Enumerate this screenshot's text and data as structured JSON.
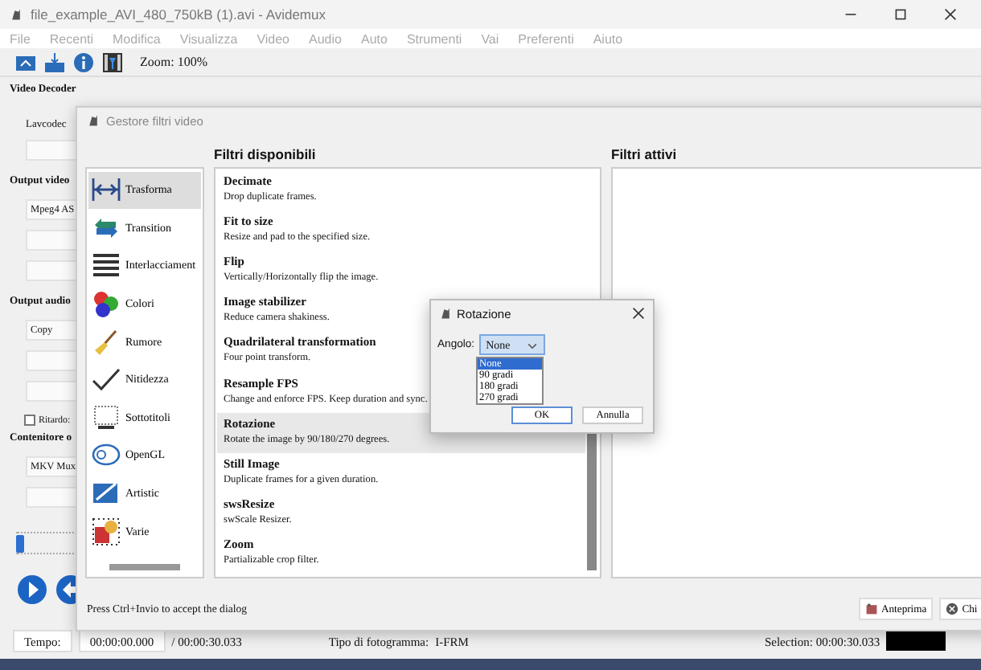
{
  "window": {
    "title": "file_example_AVI_480_750kB (1).avi - Avidemux"
  },
  "menu": [
    {
      "label": "File",
      "disabled": true
    },
    {
      "label": "Recenti",
      "disabled": true
    },
    {
      "label": "Modifica",
      "disabled": true
    },
    {
      "label": "Visualizza",
      "disabled": true
    },
    {
      "label": "Video",
      "disabled": true
    },
    {
      "label": "Audio",
      "disabled": true
    },
    {
      "label": "Auto",
      "disabled": true
    },
    {
      "label": "Strumenti",
      "disabled": true
    },
    {
      "label": "Vai",
      "disabled": true
    },
    {
      "label": "Preferenti",
      "disabled": true
    },
    {
      "label": "Aiuto",
      "disabled": true
    }
  ],
  "toolbar": {
    "zoom": "Zoom: 100%"
  },
  "main_panel": {
    "video_decoder_title": "Video Decoder",
    "decoder_label": "Lavcodec",
    "output_video_title": "Output video",
    "video_codec": "Mpeg4 AS",
    "output_audio_title": "Output audio",
    "audio_codec": "Copy",
    "delay": {
      "label": "Ritardo:",
      "checked": false
    },
    "container_title": "Contenitore o",
    "container": "MKV Mux"
  },
  "timeline": {
    "level": 0
  },
  "status_bar": {
    "time_label": "Tempo:",
    "time": "00:00:00.000",
    "duration": "/ 00:00:30.033",
    "frame_type_label": "Tipo di fotogramma:",
    "frame_type": "I-FRM",
    "selection": "Selection: 00:00:30.033"
  },
  "filter_dialog": {
    "title": "Gestore filtri video",
    "available_header": "Filtri disponibili",
    "active_header": "Filtri attivi",
    "categories": [
      {
        "label": "Trasforma",
        "selected": true
      },
      {
        "label": "Transition",
        "selected": false
      },
      {
        "label": "Interlacciament",
        "selected": false
      },
      {
        "label": "Colori",
        "selected": false
      },
      {
        "label": "Rumore",
        "selected": false
      },
      {
        "label": "Nitidezza",
        "selected": false
      },
      {
        "label": "Sottotitoli",
        "selected": false
      },
      {
        "label": "OpenGL",
        "selected": false
      },
      {
        "label": "Artistic",
        "selected": false
      },
      {
        "label": "Varie",
        "selected": false
      }
    ],
    "filters": [
      {
        "name": "Decimate",
        "description": "Drop duplicate frames.",
        "selected": false
      },
      {
        "name": "Fit to size",
        "description": "Resize and pad to the specified size.",
        "selected": false
      },
      {
        "name": "Flip",
        "description": "Vertically/Horizontally flip the image.",
        "selected": false
      },
      {
        "name": "Image stabilizer",
        "description": "Reduce camera shakiness.",
        "selected": false
      },
      {
        "name": "Quadrilateral transformation",
        "description": "Four point transform.",
        "selected": false
      },
      {
        "name": "Resample FPS",
        "description": "Change and enforce FPS. Keep duration and sync.",
        "selected": false
      },
      {
        "name": "Rotazione",
        "description": "Rotate the image by 90/180/270 degrees.",
        "selected": true
      },
      {
        "name": "Still Image",
        "description": "Duplicate frames for a given duration.",
        "selected": false
      },
      {
        "name": "swsResize",
        "description": "swScale Resizer.",
        "selected": false
      },
      {
        "name": "Zoom",
        "description": "Partializable crop filter.",
        "selected": false
      }
    ],
    "hint": "Press Ctrl+Invio to accept the dialog",
    "buttons": [
      {
        "label": "Anteprima",
        "kind": "preview"
      },
      {
        "label": "Chi",
        "kind": "close"
      }
    ]
  },
  "rotation_dialog": {
    "title": "Rotazione",
    "angle_label": "Angolo:",
    "angle_value": "None",
    "options": [
      {
        "label": "None",
        "selected": true
      },
      {
        "label": "90 gradi",
        "selected": false
      },
      {
        "label": "180 gradi",
        "selected": false
      },
      {
        "label": "270 gradi",
        "selected": false
      }
    ],
    "buttons": [
      "OK",
      "Annulla"
    ]
  }
}
